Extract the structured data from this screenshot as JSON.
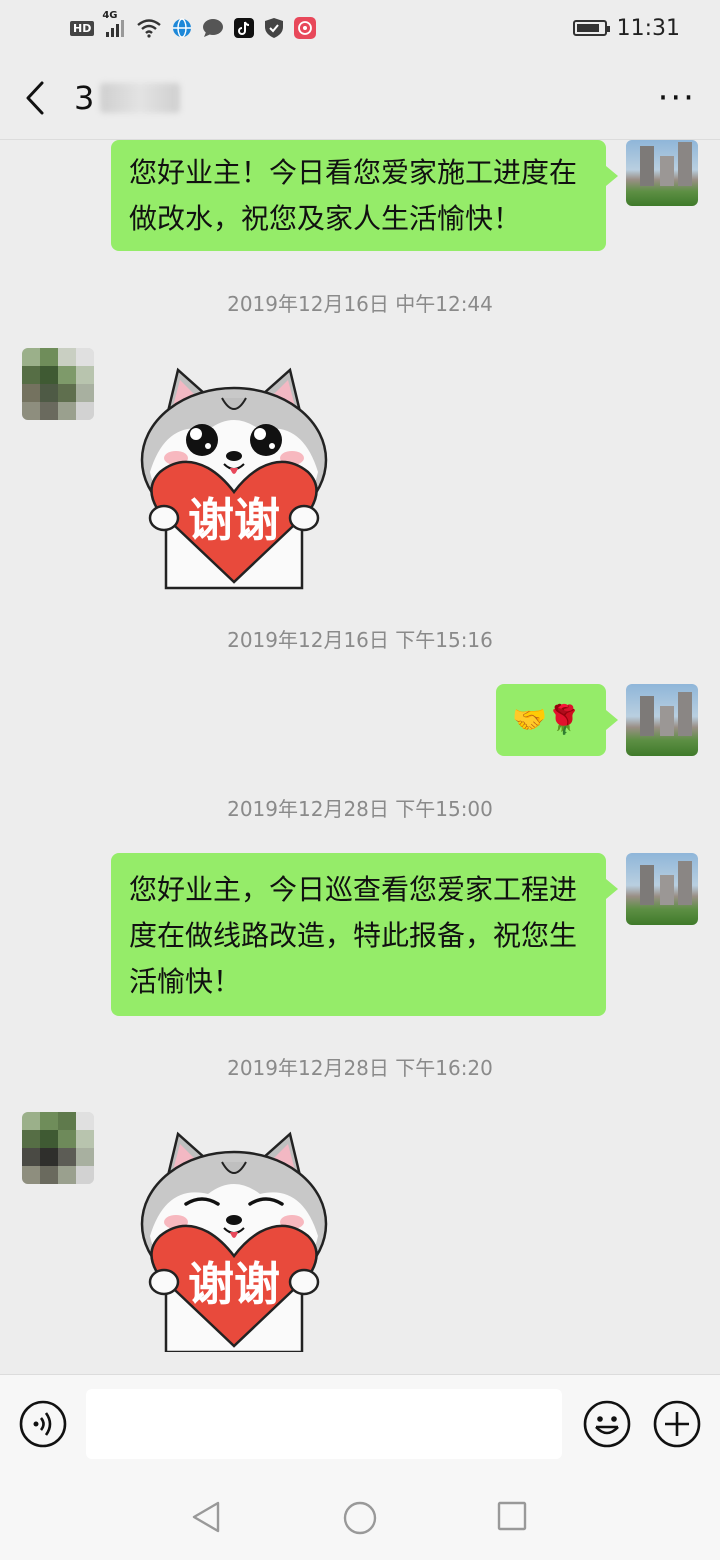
{
  "status_bar": {
    "hd_label": "HD",
    "network_label": "4G",
    "time": "11:31",
    "battery_level": 0.85,
    "icons": [
      "hd-icon",
      "signal-icon",
      "wifi-icon",
      "browser-icon",
      "message-icon",
      "tiktok-icon",
      "shield-icon",
      "app-icon",
      "battery-icon"
    ]
  },
  "header": {
    "title_visible": "3",
    "back_icon": "chevron-left-icon",
    "more_label": "···"
  },
  "messages": [
    {
      "type": "text",
      "sender": "self",
      "text": "您好业主！今日看您爱家施工进度在做改水，祝您及家人生活愉快！"
    },
    {
      "type": "timestamp",
      "text": "2019年12月16日 中午12:44"
    },
    {
      "type": "sticker",
      "sender": "other",
      "sticker_text": "谢谢",
      "sticker": "husky-thanks-heart",
      "eyes": "open"
    },
    {
      "type": "timestamp",
      "text": "2019年12月16日 下午15:16"
    },
    {
      "type": "emoji",
      "sender": "self",
      "text": "🤝🌹"
    },
    {
      "type": "timestamp",
      "text": "2019年12月28日 下午15:00"
    },
    {
      "type": "text",
      "sender": "self",
      "text": "您好业主，今日巡查看您爱家工程进度在做线路改造，特此报备，祝您生活愉快！"
    },
    {
      "type": "timestamp",
      "text": "2019年12月28日 下午16:20"
    },
    {
      "type": "sticker",
      "sender": "other",
      "sticker_text": "谢谢",
      "sticker": "husky-thanks-heart",
      "eyes": "closed"
    }
  ],
  "input_bar": {
    "placeholder": "",
    "voice_icon": "voice-icon",
    "emoji_icon": "emoji-icon",
    "plus_icon": "plus-icon"
  },
  "nav_bar": {
    "icons": [
      "back-triangle-icon",
      "home-circle-icon",
      "recents-square-icon"
    ]
  },
  "colors": {
    "background": "#ededed",
    "bubble_self": "#95ec69",
    "timestamp": "#8a8a8a",
    "sticker_heart": "#e84a3c"
  }
}
